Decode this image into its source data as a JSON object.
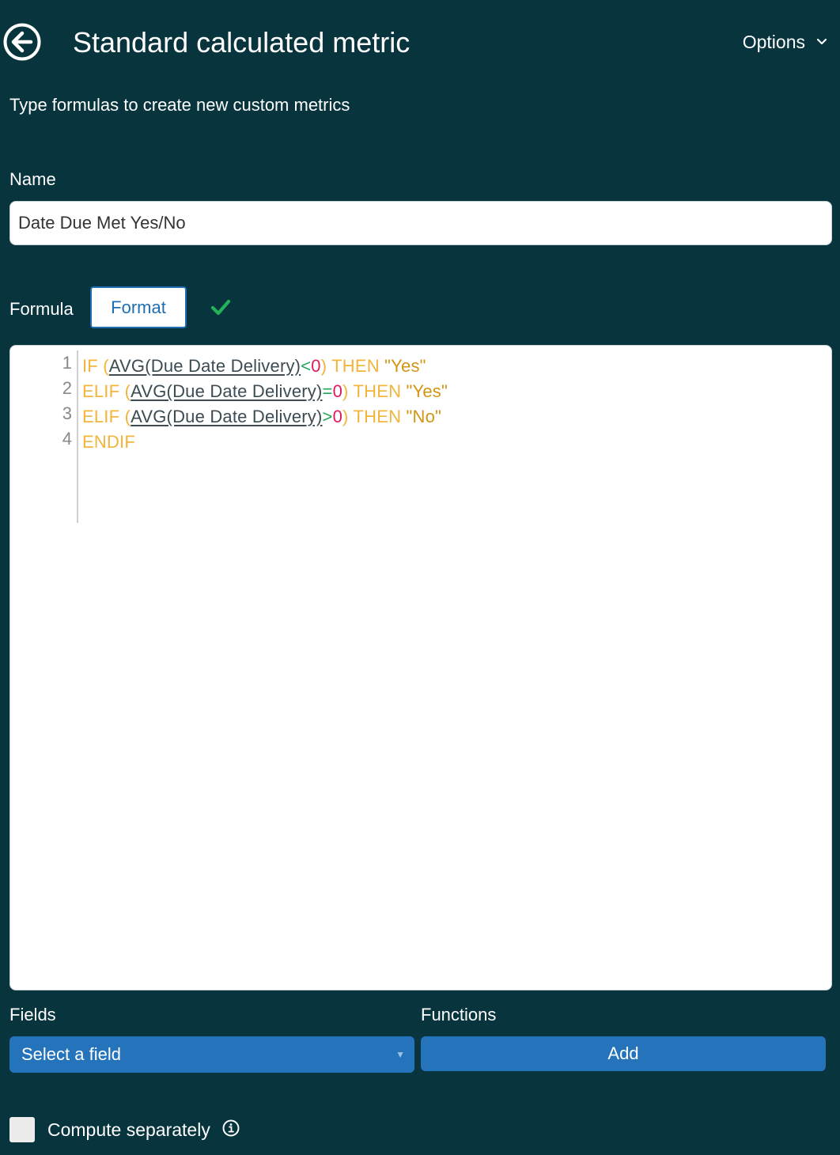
{
  "header": {
    "title": "Standard calculated metric",
    "options_label": "Options",
    "back_icon": "arrow-left-circle-icon",
    "options_icon": "chevron-down-icon"
  },
  "subtitle": "Type formulas to create new custom metrics",
  "name": {
    "label": "Name",
    "value": "Date Due Met Yes/No"
  },
  "formula": {
    "label": "Formula",
    "format_button": "Format",
    "status_icon": "checkmark-icon",
    "lines": [
      {
        "number": "1",
        "keyword": "IF",
        "open": "(",
        "func": "AVG(Due Date Delivery)",
        "op": "<",
        "num": "0",
        "close": ")",
        "then": "THEN",
        "str": "\"Yes\""
      },
      {
        "number": "2",
        "keyword": "ELIF",
        "open": "(",
        "func": "AVG(Due Date Delivery)",
        "op": "=",
        "num": "0",
        "close": ")",
        "then": "THEN",
        "str": "\"Yes\""
      },
      {
        "number": "3",
        "keyword": "ELIF",
        "open": "(",
        "func": "AVG(Due Date Delivery)",
        "op": ">",
        "num": "0",
        "close": ")",
        "then": "THEN",
        "str": "\"No\""
      },
      {
        "number": "4",
        "keyword": "ENDIF"
      }
    ]
  },
  "fields": {
    "label": "Fields",
    "select_placeholder": "Select a field",
    "caret": "▼"
  },
  "functions": {
    "label": "Functions",
    "add_button": "Add"
  },
  "compute_separately": {
    "label": "Compute separately",
    "checked": false,
    "info_icon": "info-circle-icon"
  },
  "colors": {
    "background": "#07343d",
    "accent_blue": "#2573bb",
    "keyword": "#f2b43a",
    "string": "#d29512",
    "number": "#e0195c",
    "operator": "#22a65a",
    "check": "#22b35a"
  }
}
